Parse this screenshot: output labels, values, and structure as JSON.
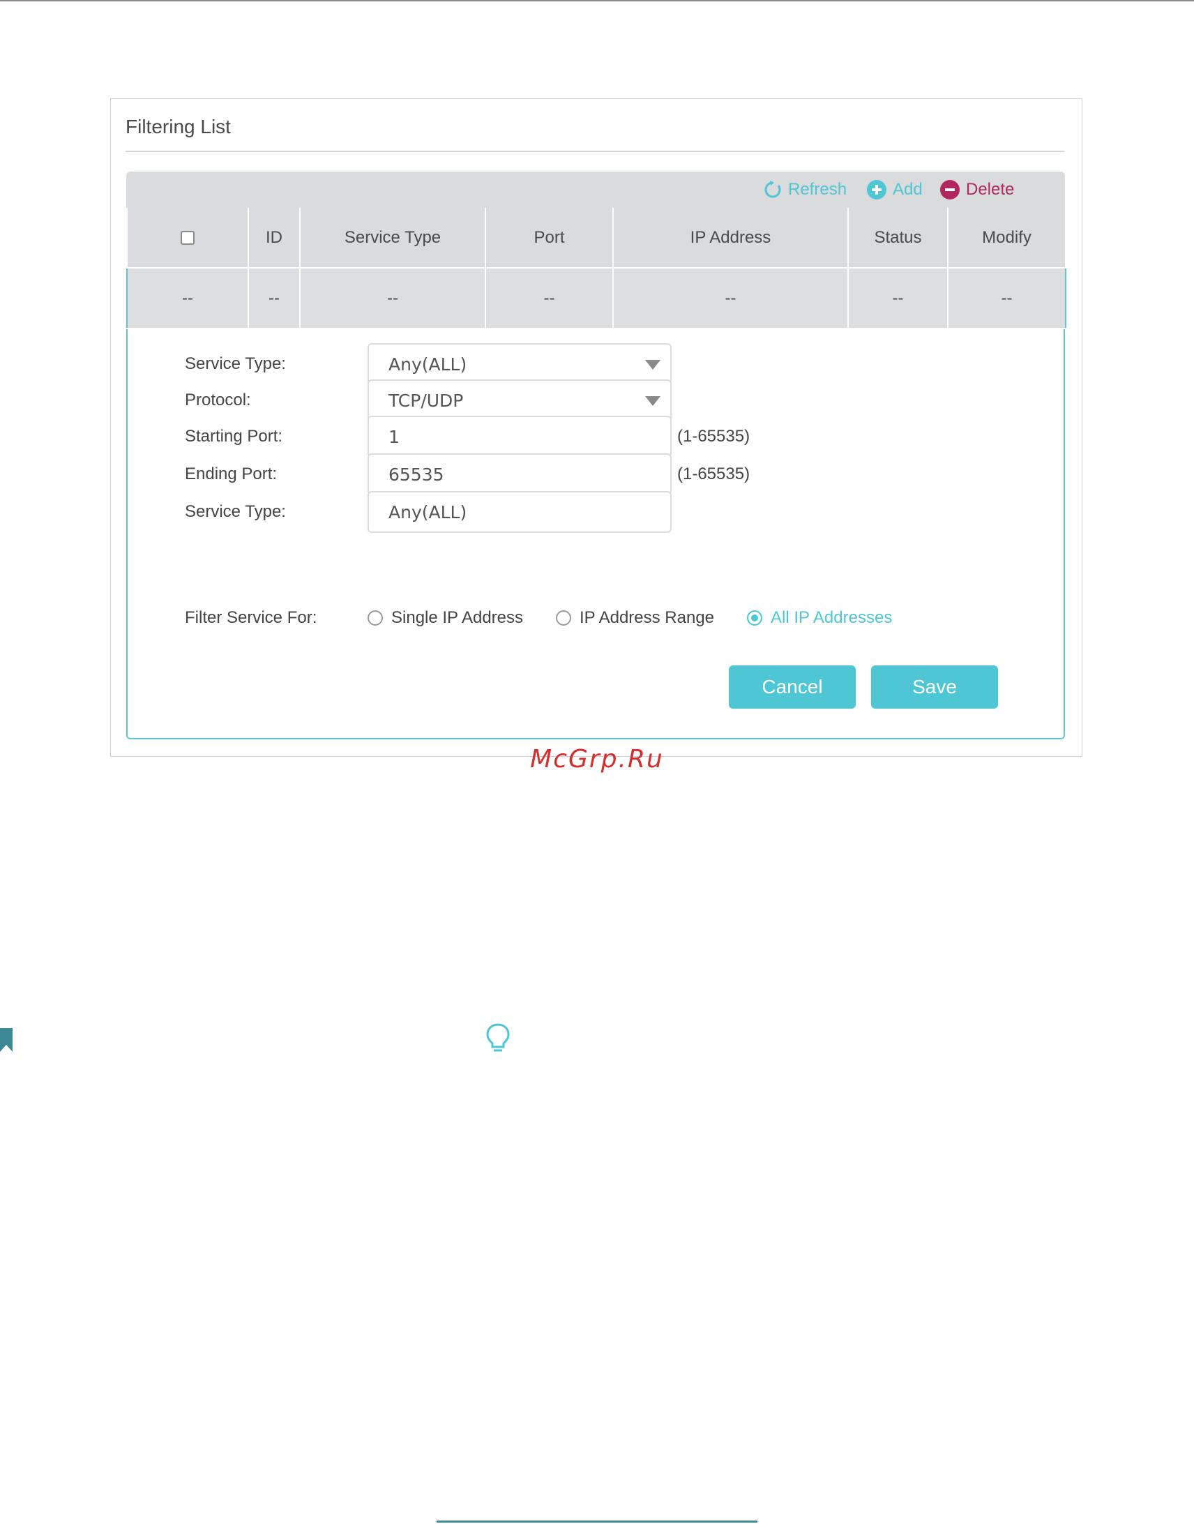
{
  "panel": {
    "title": "Filtering List",
    "toolbar": {
      "refresh_label": "Refresh",
      "add_label": "Add",
      "delete_label": "Delete"
    },
    "table": {
      "columns": [
        "ID",
        "Service Type",
        "Port",
        "IP Address",
        "Status",
        "Modify"
      ],
      "row": [
        "--",
        "--",
        "--",
        "--",
        "--",
        "--",
        "--"
      ]
    },
    "form": {
      "service_type_label": "Service Type:",
      "service_type_value": "Any(ALL)",
      "protocol_label": "Protocol:",
      "protocol_value": "TCP/UDP",
      "starting_port_label": "Starting Port:",
      "starting_port_value": "1",
      "starting_port_hint": "(1-65535)",
      "ending_port_label": "Ending Port:",
      "ending_port_value": "65535",
      "ending_port_hint": "(1-65535)",
      "service_type2_label": "Service Type:",
      "service_type2_value": "Any(ALL)",
      "filter_for_label": "Filter Service For:",
      "filter_options": [
        "Single IP Address",
        "IP Address Range",
        "All IP Addresses"
      ],
      "filter_selected": "All IP Addresses",
      "cancel_label": "Cancel",
      "save_label": "Save"
    }
  },
  "watermark": "McGrp.Ru",
  "colors": {
    "accent": "#4ec6d3",
    "delete": "#b1275f",
    "header_bg": "#d9dbdd",
    "watermark": "#d32f2f"
  },
  "icons": [
    "refresh-icon",
    "add-icon",
    "delete-icon",
    "bookmark-icon",
    "lightbulb-icon"
  ]
}
